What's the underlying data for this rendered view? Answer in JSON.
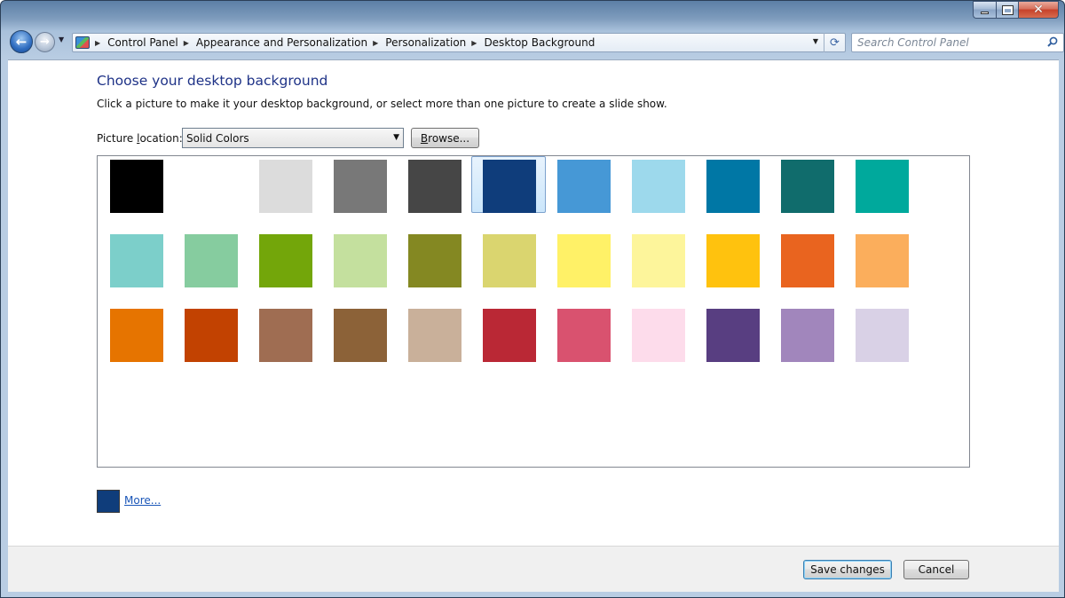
{
  "window": {
    "caption_buttons": {
      "minimize_icon": "minimize-icon",
      "maximize_icon": "maximize-icon",
      "close_glyph": "✕"
    }
  },
  "nav": {
    "back_glyph": "←",
    "forward_glyph": "→",
    "breadcrumbs": [
      "Control Panel",
      "Appearance and Personalization",
      "Personalization",
      "Desktop Background"
    ],
    "refresh_glyph": "⟳",
    "search_placeholder": "Search Control Panel"
  },
  "main": {
    "heading": "Choose your desktop background",
    "subtitle": "Click a picture to make it your desktop background, or select more than one picture to create a slide show.",
    "location_label_pre": "Picture ",
    "location_label_hotkey": "l",
    "location_label_post": "ocation:",
    "location_value": "Solid Colors",
    "browse_label_hotkey": "B",
    "browse_label_rest": "rowse...",
    "selected_color": "#0f3d7b",
    "swatches": [
      [
        "#000000",
        "#ffffff",
        "#dcdcdc",
        "#787878",
        "#464646",
        "#0f3d7b",
        "#4698d6",
        "#9dd9ec",
        "#0077a5",
        "#106c6c",
        "#00a99c"
      ],
      [
        "#7ccfca",
        "#86cc9f",
        "#73a60a",
        "#c4e09e",
        "#848822",
        "#dad56f",
        "#fff167",
        "#fdf59b",
        "#ffc20e",
        "#e9641f",
        "#fbae5c"
      ],
      [
        "#e67400",
        "#c24201",
        "#9f6d52",
        "#8c6238",
        "#c9b09a",
        "#ba2835",
        "#d9526f",
        "#fddceb",
        "#583e81",
        "#a186bc",
        "#d9d1e6"
      ]
    ],
    "more_link": "More..."
  },
  "footer": {
    "save_label": "Save changes",
    "cancel_label": "Cancel"
  }
}
